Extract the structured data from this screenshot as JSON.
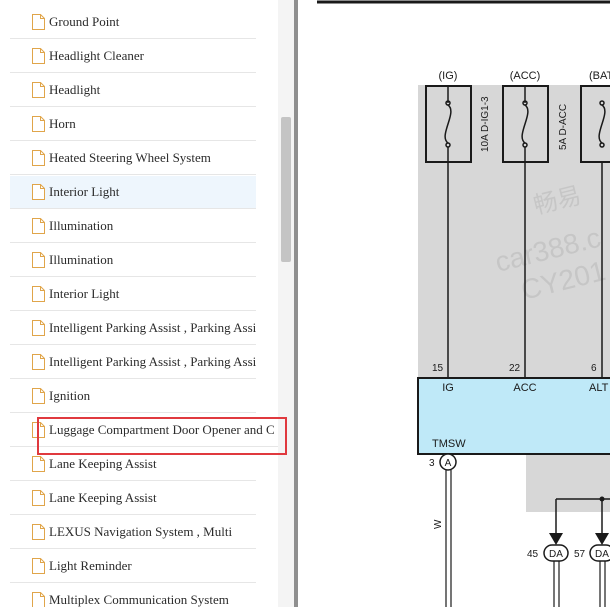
{
  "nav": {
    "items": [
      {
        "label": "Ground Point"
      },
      {
        "label": "Headlight Cleaner"
      },
      {
        "label": "Headlight"
      },
      {
        "label": "Horn"
      },
      {
        "label": "Heated Steering Wheel System"
      },
      {
        "label": "Interior Light",
        "selected": true
      },
      {
        "label": "Illumination"
      },
      {
        "label": "Illumination"
      },
      {
        "label": "Interior Light"
      },
      {
        "label": "Intelligent Parking Assist , Parking Assist"
      },
      {
        "label": "Intelligent Parking Assist , Parking Assist"
      },
      {
        "label": "Ignition"
      },
      {
        "label": "Luggage Compartment Door Opener and C"
      },
      {
        "label": "Lane Keeping Assist"
      },
      {
        "label": "Lane Keeping Assist"
      },
      {
        "label": "LEXUS Navigation System , Multi"
      },
      {
        "label": "Light Reminder"
      },
      {
        "label": "Multiplex Communication System"
      }
    ]
  },
  "diagram": {
    "fuses": [
      {
        "source": "(IG)",
        "rating": "10A D-IG1-3"
      },
      {
        "source": "(ACC)",
        "rating": "5A D-ACC"
      },
      {
        "source": "(BAT",
        "rating": ""
      }
    ],
    "pins": [
      {
        "number": "15",
        "name": "IG"
      },
      {
        "number": "22",
        "name": "ACC"
      },
      {
        "number": "6",
        "name": "ALT"
      }
    ],
    "component_label": "TMSW",
    "ground": {
      "pin": "3",
      "connector": "A"
    },
    "wire_color": "W",
    "connectors": [
      {
        "pin": "45",
        "code": "DA"
      },
      {
        "pin": "57",
        "code": "DA"
      }
    ],
    "watermark": [
      "畅易",
      "car388.c",
      "CY201"
    ],
    "colors": {
      "shade": "#d7d7d7",
      "component": "#bfe9f8",
      "outline": "#1a1a1a"
    }
  }
}
